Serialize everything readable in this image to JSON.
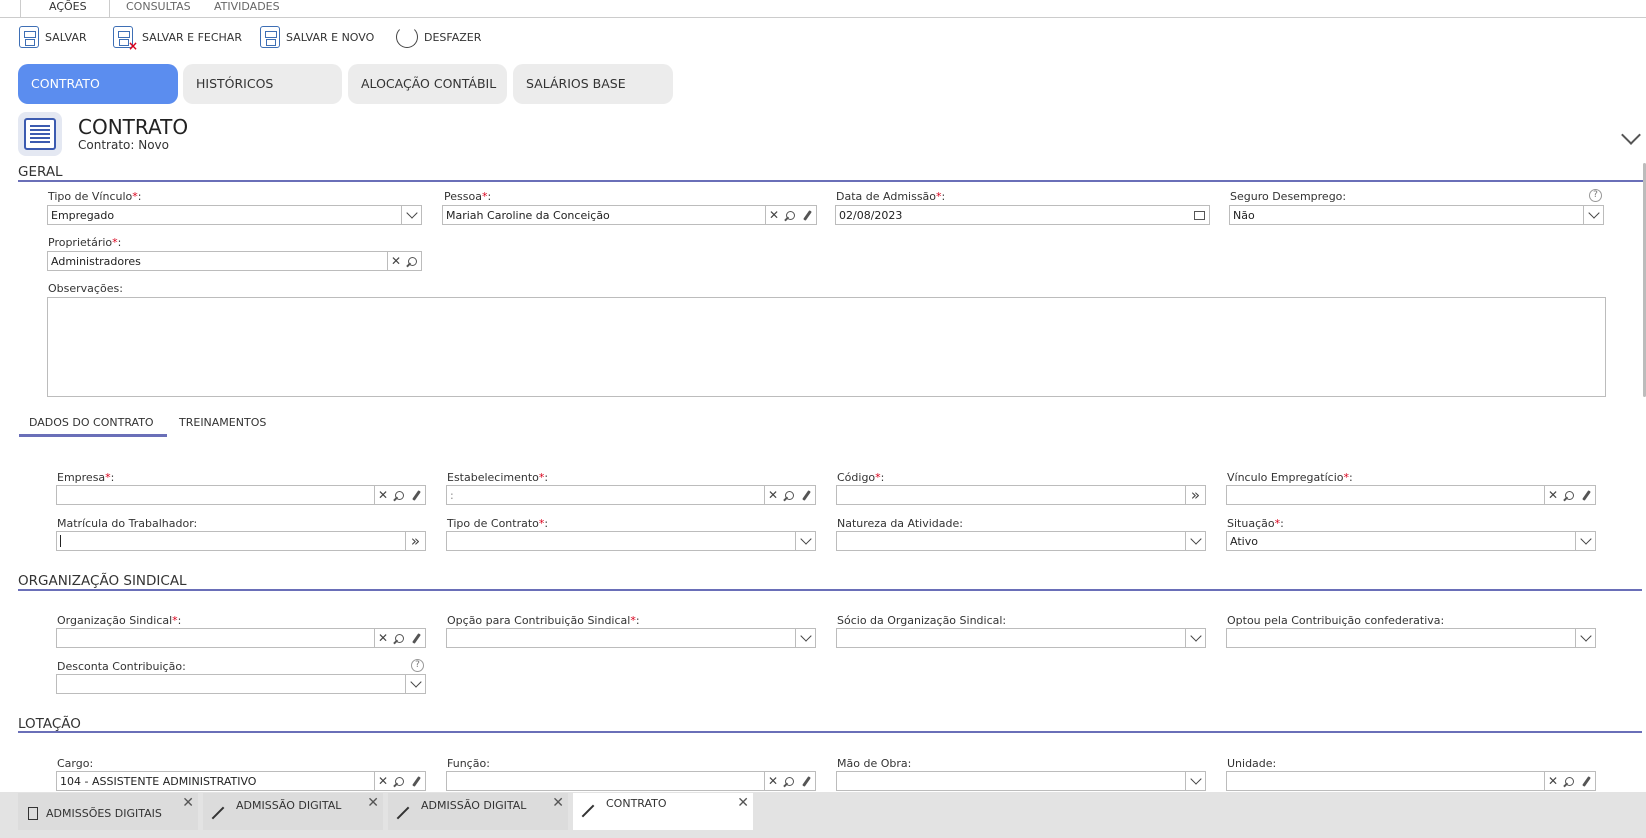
{
  "top_tabs": [
    "AÇÕES",
    "CONSULTAS",
    "ATIVIDADES"
  ],
  "toolbar": {
    "salvar": "SALVAR",
    "salvar_fechar": "SALVAR E FECHAR",
    "salvar_novo": "SALVAR E NOVO",
    "desfazer": "DESFAZER"
  },
  "main_tabs": [
    "CONTRATO",
    "HISTÓRICOS",
    "ALOCAÇÃO CONTÁBIL",
    "SALÁRIOS BASE"
  ],
  "header": {
    "title": "CONTRATO",
    "subtitle": "Contrato: Novo"
  },
  "sections": {
    "geral": "GERAL",
    "organizacao_sindical": "ORGANIZAÇÃO SINDICAL",
    "lotacao": "LOTAÇÃO"
  },
  "geral": {
    "tipo_vinculo": {
      "label": "Tipo de Vínculo",
      "value": "Empregado"
    },
    "pessoa": {
      "label": "Pessoa",
      "value": "Mariah Caroline da Conceição"
    },
    "data_admissao": {
      "label": "Data de Admissão",
      "value": "02/08/2023"
    },
    "seguro_desemprego": {
      "label": "Seguro Desemprego:",
      "value": "Não"
    },
    "proprietario": {
      "label": "Proprietário",
      "value": "Administradores"
    },
    "observacoes": {
      "label": "Observações:",
      "value": ""
    }
  },
  "sub_tabs": [
    "DADOS DO CONTRATO",
    "TREINAMENTOS"
  ],
  "dados_contrato": {
    "empresa": {
      "label": "Empresa",
      "value": ""
    },
    "estabelecimento": {
      "label": "Estabelecimento",
      "value": ":"
    },
    "codigo": {
      "label": "Código",
      "value": ""
    },
    "vinculo_empregaticio": {
      "label": "Vínculo Empregatício",
      "value": ""
    },
    "matricula": {
      "label": "Matrícula do Trabalhador:",
      "value": ""
    },
    "tipo_contrato": {
      "label": "Tipo de Contrato",
      "value": ""
    },
    "natureza_atividade": {
      "label": "Natureza da Atividade:",
      "value": ""
    },
    "situacao": {
      "label": "Situação",
      "value": "Ativo"
    }
  },
  "sindical": {
    "organizacao": {
      "label": "Organização Sindical",
      "value": ""
    },
    "opcao_contribuicao": {
      "label": "Opção para Contribuição Sindical",
      "value": ""
    },
    "socio": {
      "label": "Sócio da Organização Sindical:",
      "value": ""
    },
    "optou_confederativa": {
      "label": "Optou pela Contribuição confederativa:",
      "value": ""
    },
    "desconta_contribuicao": {
      "label": "Desconta Contribuição:",
      "value": ""
    }
  },
  "lotacao": {
    "cargo": {
      "label": "Cargo:",
      "value": "104 - ASSISTENTE ADMINISTRATIVO"
    },
    "funcao": {
      "label": "Função:",
      "value": ""
    },
    "mao_obra": {
      "label": "Mão de Obra:",
      "value": ""
    },
    "unidade": {
      "label": "Unidade:",
      "value": ""
    }
  },
  "tasks": [
    "ADMISSÕES DIGITAIS",
    "ADMISSÃO DIGITAL",
    "ADMISSÃO DIGITAL",
    "CONTRATO"
  ],
  "required_mark": "*",
  "help_mark": "?"
}
